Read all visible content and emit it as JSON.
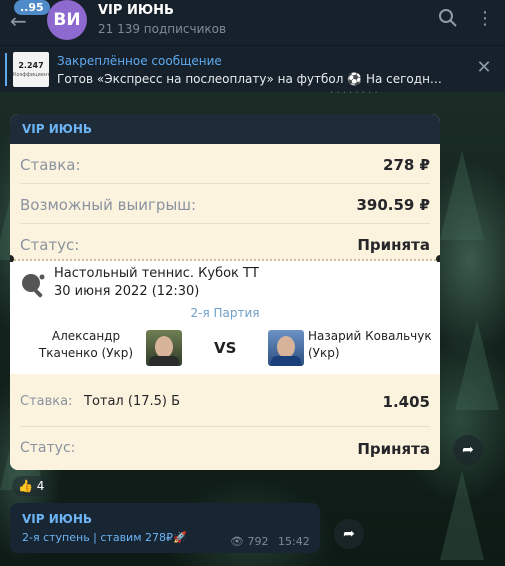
{
  "header": {
    "unread_badge": "..95",
    "avatar_initials": "ВИ",
    "title": "VIP ИЮНЬ",
    "subscribers": "21 139 подписчиков"
  },
  "pinned": {
    "title": "Закреплённое сообщение",
    "text": "Готов «Экспресс на послеоплату» на футбол ⚽  На сегодня ...",
    "thumb_value": "2.247",
    "thumb_caption": "Коэффициент"
  },
  "card": {
    "channel": "VIP ИЮНЬ",
    "rows": [
      {
        "label": "Ставка:",
        "value": "278 ₽"
      },
      {
        "label": "Возможный выигрыш:",
        "value": "390.59 ₽"
      },
      {
        "label": "Статус:",
        "value": "Принята"
      }
    ],
    "match": {
      "tournament": "Настольный теннис. Кубок ТТ",
      "date": "30 июня 2022 (12:30)",
      "part": "2-я Партия",
      "player1": "Александр Ткаченко (Укр)",
      "vs": "VS",
      "player2": "Назарий Ковальчук (Укр)"
    },
    "bet": {
      "label": "Ставка:",
      "desc": "Тотал (17.5) Б",
      "odds": "1.405",
      "status_label": "Статус:",
      "status_value": "Принята"
    }
  },
  "reaction": {
    "emoji": "👍",
    "count": "4"
  },
  "message2": {
    "author": "VIP ИЮНЬ",
    "body": "2-я ступень | ставим 278₽🚀",
    "views": "792",
    "time": "15:42"
  },
  "colors": {
    "header_bg": "#17212b",
    "accent": "#5eaaf0",
    "card_cream": "#fbf3dd"
  }
}
